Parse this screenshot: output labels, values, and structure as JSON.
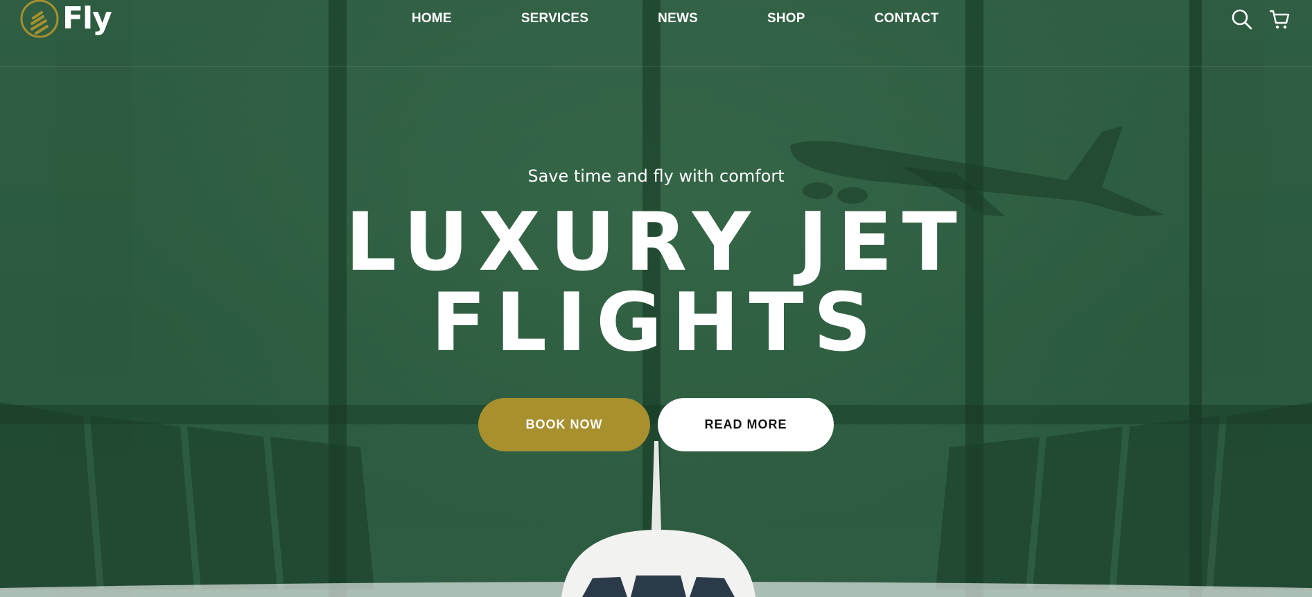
{
  "brand": {
    "name": "Fly"
  },
  "nav": {
    "items": [
      {
        "label": "HOME"
      },
      {
        "label": "SERVICES"
      },
      {
        "label": "NEWS"
      },
      {
        "label": "SHOP"
      },
      {
        "label": "CONTACT"
      }
    ]
  },
  "header_icons": [
    "search-icon",
    "cart-icon"
  ],
  "hero": {
    "subtitle": "Save time and fly with comfort",
    "headline_line1": "LUXURY JET",
    "headline_line2": "FLIGHTS",
    "book_label": "BOOK NOW",
    "read_label": "READ MORE"
  },
  "colors": {
    "background": "#2c5a3f",
    "accent_gold": "#a8902f",
    "text": "#ffffff",
    "button_light": "#ffffff"
  }
}
